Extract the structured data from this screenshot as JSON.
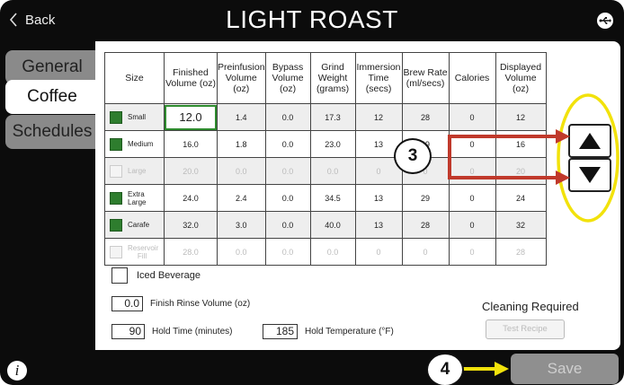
{
  "header": {
    "back_label": "Back",
    "title": "LIGHT ROAST",
    "usb_icon": "usb-icon"
  },
  "tabs": [
    {
      "label": "General",
      "active": false
    },
    {
      "label": "Coffee",
      "active": true
    },
    {
      "label": "Schedules",
      "active": false
    }
  ],
  "table": {
    "headers": [
      "Size",
      "Finished Volume (oz)",
      "Preinfusion Volume (oz)",
      "Bypass Volume (oz)",
      "Grind Weight (grams)",
      "Immersion Time (secs)",
      "Brew Rate (ml/secs)",
      "Calories",
      "Displayed Volume (oz)"
    ],
    "rows": [
      {
        "size": "Small",
        "checked": true,
        "enabled": true,
        "finished": "12.0",
        "preinfusion": "1.4",
        "bypass": "0.0",
        "grind": "17.3",
        "immersion": "12",
        "brew_rate": "28",
        "calories": "0",
        "displayed": "12"
      },
      {
        "size": "Medium",
        "checked": true,
        "enabled": true,
        "finished": "16.0",
        "preinfusion": "1.8",
        "bypass": "0.0",
        "grind": "23.0",
        "immersion": "13",
        "brew_rate": "29",
        "calories": "0",
        "displayed": "16"
      },
      {
        "size": "Large",
        "checked": false,
        "enabled": false,
        "finished": "20.0",
        "preinfusion": "0.0",
        "bypass": "0.0",
        "grind": "0.0",
        "immersion": "0",
        "brew_rate": "0",
        "calories": "0",
        "displayed": "20"
      },
      {
        "size": "Extra Large",
        "checked": true,
        "enabled": true,
        "finished": "24.0",
        "preinfusion": "2.4",
        "bypass": "0.0",
        "grind": "34.5",
        "immersion": "13",
        "brew_rate": "29",
        "calories": "0",
        "displayed": "24"
      },
      {
        "size": "Carafe",
        "checked": true,
        "enabled": true,
        "finished": "32.0",
        "preinfusion": "3.0",
        "bypass": "0.0",
        "grind": "40.0",
        "immersion": "13",
        "brew_rate": "28",
        "calories": "0",
        "displayed": "32"
      },
      {
        "size": "Reservoir Fill",
        "checked": false,
        "enabled": false,
        "finished": "28.0",
        "preinfusion": "0.0",
        "bypass": "0.0",
        "grind": "0.0",
        "immersion": "0",
        "brew_rate": "0",
        "calories": "0",
        "displayed": "28"
      }
    ]
  },
  "iced_beverage_label": "Iced Beverage",
  "finish_rinse": {
    "value": "0.0",
    "label": "Finish Rinse Volume (oz)"
  },
  "hold_time": {
    "value": "90",
    "label": "Hold Time (minutes)"
  },
  "hold_temp": {
    "value": "185",
    "label": "Hold Temperature (°F)"
  },
  "cleaning_label": "Cleaning Required",
  "test_recipe_label": "Test Recipe",
  "save_label": "Save",
  "info_label": "i",
  "annotations": {
    "callout_3": "3",
    "callout_4": "4"
  },
  "colors": {
    "accent_green": "#2e7d2e",
    "annotation_red": "#c0392b",
    "annotation_yellow": "#f2e20b"
  }
}
